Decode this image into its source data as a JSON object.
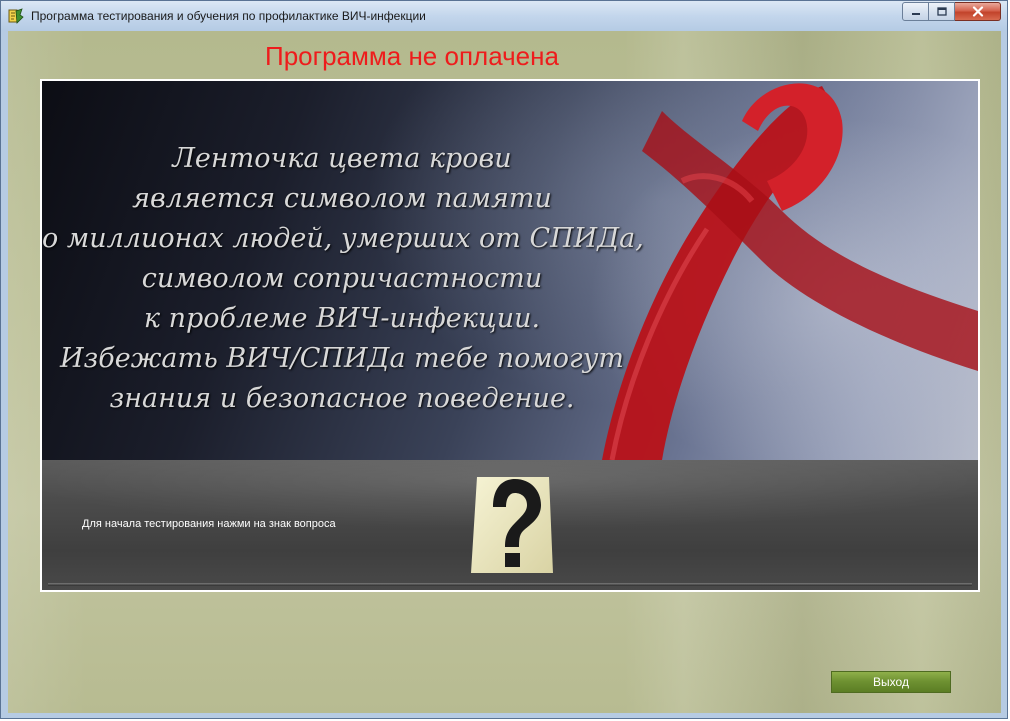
{
  "window": {
    "title": "Программа тестирования и обучения по профилактике ВИЧ-инфекции",
    "controls": {
      "minimize_icon": "minimize-icon",
      "maximize_icon": "maximize-icon",
      "close_icon": "close-icon"
    }
  },
  "main": {
    "status_text": "Программа не оплачена",
    "banner": {
      "quote_lines": [
        "Ленточка цвета крови",
        "является символом памяти",
        "о миллионах людей, умерших от СПИДа,",
        "символом сопричастности",
        "к проблеме ВИЧ-инфекции.",
        "Избежать ВИЧ/СПИДа тебе помогут",
        "знания и безопасное поведение."
      ],
      "hint_text": "Для начала тестирования нажми на знак вопроса",
      "start_icon": "question-mark-icon"
    },
    "exit_label": "Выход"
  },
  "colors": {
    "status_text": "#ee1c1c",
    "ribbon": "#c8161d",
    "background": "#bcc097",
    "exit_button": "#6f9232"
  }
}
